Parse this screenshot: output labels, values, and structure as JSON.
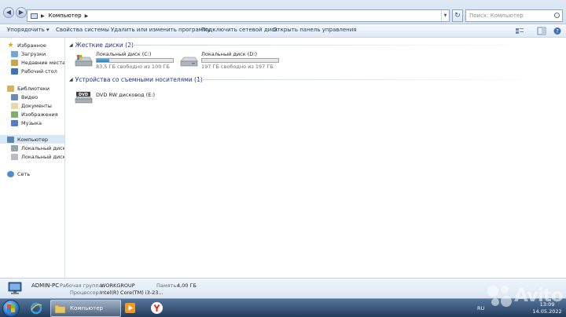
{
  "address_bar": {
    "path": "Компьютер",
    "search_placeholder": "Поиск: Компьютер"
  },
  "toolbar": {
    "organize": "Упорядочить ▾",
    "system_properties": "Свойства системы",
    "uninstall": "Удалить или изменить программу",
    "map_drive": "Подключить сетевой диск",
    "control_panel": "Открыть панель управления"
  },
  "nav": {
    "favorites": "Избранное",
    "downloads": "Загрузки",
    "recent": "Недавние места",
    "desktop": "Рабочий стол",
    "libraries": "Библиотеки",
    "video": "Видео",
    "documents": "Документы",
    "images": "Изображения",
    "music": "Музыка",
    "computer": "Компьютер",
    "drive_c": "Локальный диск (C",
    "drive_d": "Локальный диск (D",
    "network": "Сеть"
  },
  "groups": {
    "hard_drives": "Жесткие диски (2)",
    "removable": "Устройства со съемными носителями (1)"
  },
  "drives": [
    {
      "name": "Локальный диск (C:)",
      "free": "83,5 ГБ свободно из 100 ГБ",
      "used_fraction": 0.165
    },
    {
      "name": "Локальный диск (D:)",
      "free": "197 ГБ свободно из 197 ГБ",
      "used_fraction": 0.0
    }
  ],
  "removable": {
    "name": "DVD RW дисковод (E:)",
    "icon_label": "DVD"
  },
  "details": {
    "pc_name": "ADMIN-PC",
    "workgroup_key": "Рабочая группа:",
    "workgroup_val": "WORKGROUP",
    "memory_key": "Память:",
    "memory_val": "4,00 ГБ",
    "cpu_key": "Процессор:",
    "cpu_val": "Intel(R) Core(TM) i3-23..."
  },
  "taskbar": {
    "explorer_label": "Компьютер",
    "lang": "RU",
    "time": "13:09",
    "date": "14.05.2022"
  },
  "watermark": "Avito",
  "colors": {
    "drive_fill": "#1f86c6",
    "group_header": "#1e3287",
    "taskbar": "#223c5e"
  }
}
